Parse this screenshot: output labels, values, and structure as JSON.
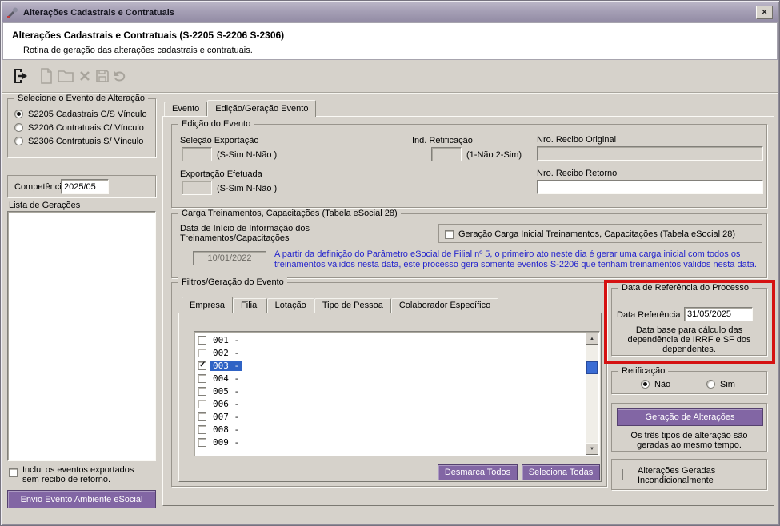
{
  "window": {
    "title": "Alterações Cadastrais e Contratuais"
  },
  "header": {
    "title": "Alterações Cadastrais e Contratuais (S-2205 S-2206 S-2306)",
    "subtitle": "Rotina de geração das alterações cadastrais e contratuais."
  },
  "toolbar": {
    "buttons": [
      "exit",
      "new-document",
      "open-folder",
      "delete",
      "save",
      "undo"
    ]
  },
  "sidebar": {
    "event_group_title": "Selecione o Evento de Alteração",
    "event_options": [
      {
        "label": "S2205 Cadastrais C/S Vínculo",
        "selected": true
      },
      {
        "label": "S2206 Contratuais C/ Vínculo",
        "selected": false
      },
      {
        "label": "S2306 Contratuais S/ Vínculo",
        "selected": false
      }
    ],
    "competencia_label": "Competência",
    "competencia_value": "2025/05",
    "lista_label": "Lista de Gerações",
    "include_exported": {
      "line1": "Inclui os eventos exportados",
      "line2": "sem recibo de retorno.",
      "checked": false
    },
    "envio_button_label": "Envio Evento Ambiente eSocial"
  },
  "main_tabs": [
    {
      "label": "Evento",
      "active": false
    },
    {
      "label": "Edição/Geração Evento",
      "active": true
    }
  ],
  "edicao": {
    "title": "Edição do Evento",
    "selecao_exportacao_label": "Seleção Exportação",
    "selecao_exportacao_hint": "(S-Sim N-Não )",
    "selecao_exportacao_value": "",
    "exportacao_efetuada_label": "Exportação Efetuada",
    "exportacao_efetuada_hint": "(S-Sim N-Não )",
    "exportacao_efetuada_value": "",
    "ind_retificacao_label": "Ind. Retificação",
    "ind_retificacao_hint": "(1-Não 2-Sim)",
    "ind_retificacao_value": "",
    "recibo_original_label": "Nro. Recibo Original",
    "recibo_original_value": "",
    "recibo_retorno_label": "Nro. Recibo Retorno",
    "recibo_retorno_value": ""
  },
  "carga": {
    "title": "Carga Treinamentos, Capacitações (Tabela eSocial 28)",
    "data_inicio_line1": "Data de Início de Informação dos",
    "data_inicio_line2": "Treinamentos/Capacitações",
    "data_inicio_value": "10/01/2022",
    "carga_checkbox_label": "Geração Carga Inicial Treinamentos, Capacitações (Tabela eSocial 28)",
    "carga_checkbox_checked": false,
    "info_line1": "A partir da definição do Parâmetro eSocial de Filial nº 5, o primeiro ato neste dia é gerar uma carga inicial com todos os",
    "info_line2": "treinamentos válidos nesta data, este processo gera somente eventos S-2206 que tenham treinamentos válidos nesta data."
  },
  "filtros": {
    "title": "Filtros/Geração do Evento",
    "tabs": [
      {
        "label": "Empresa",
        "active": true
      },
      {
        "label": "Filial",
        "active": false
      },
      {
        "label": "Lotação",
        "active": false
      },
      {
        "label": "Tipo de Pessoa",
        "active": false
      },
      {
        "label": "Colaborador Específico",
        "active": false
      }
    ],
    "companies": [
      {
        "code": "001 -",
        "checked": false,
        "selected": false
      },
      {
        "code": "002 -",
        "checked": false,
        "selected": false
      },
      {
        "code": "003 -",
        "checked": true,
        "selected": true
      },
      {
        "code": "004 -",
        "checked": false,
        "selected": false
      },
      {
        "code": "005 -",
        "checked": false,
        "selected": false
      },
      {
        "code": "006 -",
        "checked": false,
        "selected": false
      },
      {
        "code": "007 -",
        "checked": false,
        "selected": false
      },
      {
        "code": "008 -",
        "checked": false,
        "selected": false
      },
      {
        "code": "009 -",
        "checked": false,
        "selected": false
      }
    ],
    "desmarca_button": "Desmarca Todos",
    "seleciona_button": "Seleciona Todas"
  },
  "referencia": {
    "title": "Data de Referência do Processo",
    "label": "Data Referência",
    "value": "31/05/2025",
    "note1": "Data base para cálculo das",
    "note2": "dependência de IRRF e SF dos",
    "note3": "dependentes."
  },
  "retificacao": {
    "title": "Retificação",
    "options": [
      {
        "label": "Não",
        "selected": true
      },
      {
        "label": "Sim",
        "selected": false
      }
    ]
  },
  "geracao": {
    "button_label": "Geração de Alterações",
    "note1": "Os três tipos de alteração são",
    "note2": "geradas ao mesmo tempo."
  },
  "incondicional": {
    "line1": "Alterações Geradas",
    "line2": "Incondicionalmente",
    "checked": false
  },
  "colors": {
    "accent_purple": "#8266a4",
    "annotation_red": "#d51111",
    "selection_blue": "#2f63c5",
    "info_blue": "#2424cc"
  }
}
